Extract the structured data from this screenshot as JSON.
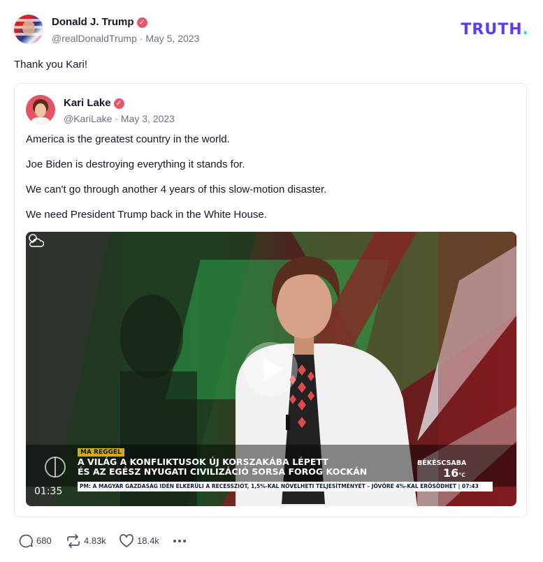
{
  "brand": {
    "name": "TRUTH",
    "dot": ".",
    "color": "#5b3df5",
    "dot_color": "#1ee7b9"
  },
  "post": {
    "author": {
      "display_name": "Donald J. Trump",
      "handle": "@realDonaldTrump",
      "verified": true
    },
    "separator": "·",
    "date": "May 5, 2023",
    "text": "Thank you Kari!",
    "actions": {
      "replies": "680",
      "reposts": "4.83k",
      "likes": "18.4k"
    }
  },
  "quoted_post": {
    "author": {
      "display_name": "Kari Lake",
      "handle": "@KariLake",
      "verified": true
    },
    "separator": "·",
    "date": "May 3, 2023",
    "paragraphs": [
      "America is the greatest country in the world.",
      "Joe Biden is destroying everything it stands for.",
      "We can't go through another 4 years of this slow-motion disaster.",
      "We need President Trump back in the White House."
    ],
    "video": {
      "duration": "01:35",
      "overlay": {
        "tag": "MA REGGEL",
        "headline_line_1": "A VILÁG A KONFLIKTUSOK ÚJ KORSZAKÁBA LÉPETT",
        "headline_line_2": "ÉS AZ EGÉSZ NYUGATI CIVILIZÁCIÓ SORSA FOROG KOCKÁN",
        "ticker": "PM: A MAGYAR GAZDASÁG IDÉN ELKERÜLI A RECESSZIÓT, 1,5%-KAL NÖVELHETI TELJESÍTMÉNYÉT – JÖVŐRE 4%-KAL ERŐSÖDHET | 07:43",
        "city": "BÉKÉSCSABA",
        "temperature": "16",
        "temperature_unit": "°C"
      }
    }
  },
  "icons": {
    "verified": "verified-badge-icon",
    "reply": "reply-icon",
    "repost": "repost-icon",
    "like": "heart-icon",
    "more": "more-options-icon",
    "play": "play-icon",
    "weather": "weather-partly-cloudy-icon"
  },
  "colors": {
    "verified_badge": "#e9566a",
    "text_primary": "#111827",
    "text_secondary": "#6b7280"
  }
}
